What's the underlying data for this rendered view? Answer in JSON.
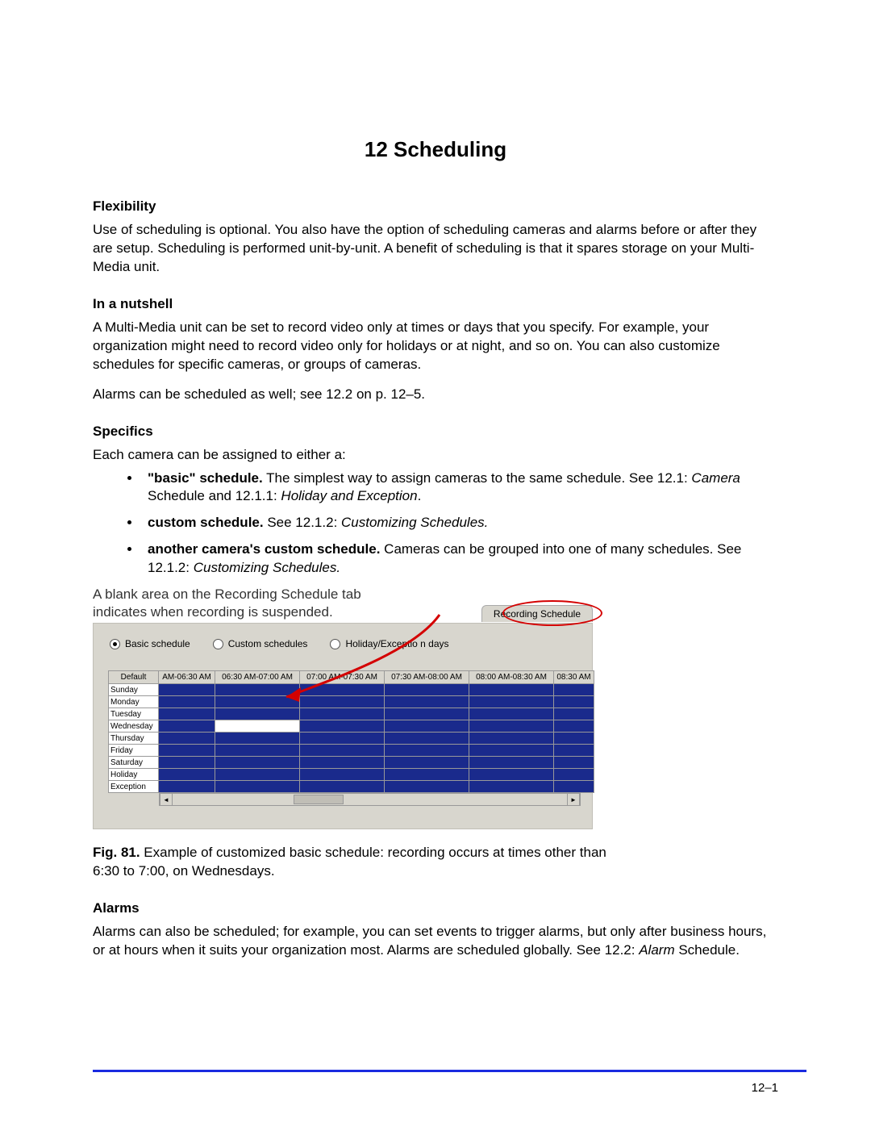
{
  "title": "12  Scheduling",
  "sections": {
    "flexibility": {
      "heading": "Flexibility",
      "p1": "Use of scheduling is optional. You also have the option of scheduling cameras and alarms before or after they are setup. Scheduling is performed unit-by-unit. A benefit of scheduling is that it spares storage on your Multi-Media unit."
    },
    "nutshell": {
      "heading": "In a nutshell",
      "p1": "A Multi-Media unit can be set to record video only at times or days that you specify. For example, your organization might need to record video only for holidays or at night, and so on. You can also customize schedules for specific cameras, or groups of cameras.",
      "p2": "Alarms can be scheduled as well; see 12.2 on p. 12–5."
    },
    "specifics": {
      "heading": "Specifics",
      "intro": "Each camera can be assigned to either a:",
      "bullets": [
        {
          "lead": "\"basic\" schedule.",
          "rest_a": " The simplest way to assign cameras to the same schedule. See 12.1: ",
          "em1": "Camera",
          "mid": " Schedule and 12.1.1: ",
          "em2": "Holiday and Exception",
          "tail": "."
        },
        {
          "lead": "custom schedule.",
          "rest_a": " See 12.1.2: ",
          "em1": "Customizing Schedules.",
          "mid": "",
          "em2": "",
          "tail": ""
        },
        {
          "lead": "another camera's custom schedule.",
          "rest_a": " Cameras can be grouped into one of many schedules. See 12.1.2: ",
          "em1": "Customizing Schedules.",
          "mid": "",
          "em2": "",
          "tail": ""
        }
      ]
    },
    "alarms": {
      "heading": "Alarms",
      "p1_a": "Alarms can also be scheduled; for example, you can set events to trigger alarms, but only after business hours, or at hours when it suits your organization most. Alarms are scheduled globally. See 12.2: ",
      "p1_em": "Alarm",
      "p1_b": " Schedule."
    }
  },
  "figure": {
    "note_line1": "A blank area on the Recording Schedule tab",
    "note_line2": "indicates when recording is suspended.",
    "tab_label": "Recording Schedule",
    "radios": [
      "Basic schedule",
      "Custom schedules",
      "Holiday/Exceptio n days"
    ],
    "radio_selected": 0,
    "col_day": "Default",
    "cols": [
      "AM-06:30 AM",
      "06:30 AM-07:00 AM",
      "07:00 AM-07:30 AM",
      "07:30 AM-08:00 AM",
      "08:00 AM-08:30 AM",
      "08:30 AM"
    ],
    "rows": [
      "Sunday",
      "Monday",
      "Tuesday",
      "Wednesday",
      "Thursday",
      "Friday",
      "Saturday",
      "Holiday",
      "Exception"
    ],
    "blank_cell": {
      "row": "Wednesday",
      "col_index": 1
    },
    "caption_lead": "Fig. 81. ",
    "caption_rest": "Example of customized basic schedule: recording occurs at times other than 6:30 to 7:00, on Wednesdays."
  },
  "page_number": "12–1"
}
